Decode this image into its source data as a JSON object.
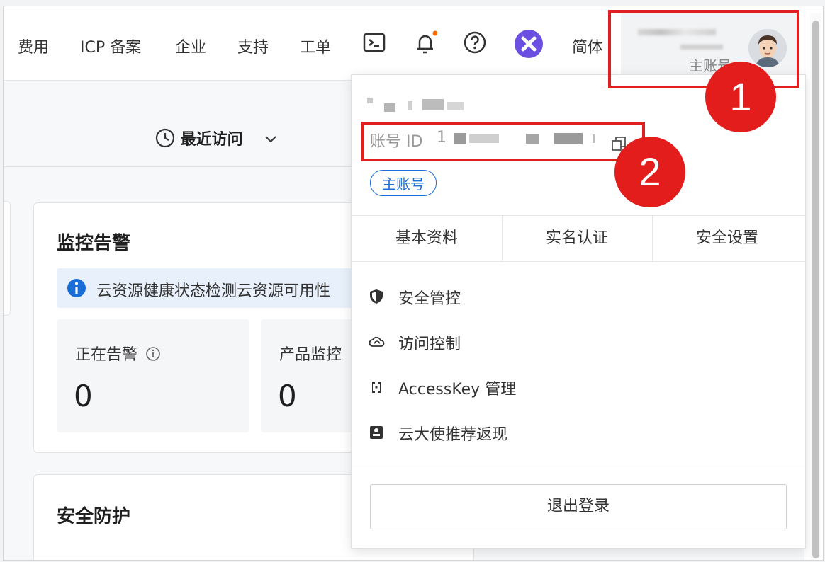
{
  "nav": {
    "items": [
      "费用",
      "ICP 备案",
      "企业",
      "支持",
      "工单"
    ],
    "lang": "简体",
    "icons": [
      "terminal-icon",
      "bell-icon",
      "help-icon",
      "app-logo-icon"
    ]
  },
  "account": {
    "role": "主账号"
  },
  "main": {
    "recent_label": "最近访问",
    "monitor_title": "监控告警",
    "alert_text": "云资源健康状态检测云资源可用性",
    "stat1_label": "正在告警",
    "stat1_value": "0",
    "stat2_label": "产品监控",
    "stat2_value": "0",
    "security_title": "安全防护"
  },
  "dropdown": {
    "id_label": "账号 ID",
    "id_value_prefix": "1",
    "badge": "主账号",
    "tabs": [
      "基本资料",
      "实名认证",
      "安全设置"
    ],
    "menu": [
      {
        "label": "安全管控",
        "icon": "shield-icon"
      },
      {
        "label": "访问控制",
        "icon": "cloud-icon"
      },
      {
        "label": "AccessKey 管理",
        "icon": "key-icon"
      },
      {
        "label": "云大使推荐返现",
        "icon": "reward-icon"
      }
    ],
    "logout": "退出登录"
  },
  "annotations": {
    "callout1": "1",
    "callout2": "2",
    "color": "#e31c1c"
  }
}
